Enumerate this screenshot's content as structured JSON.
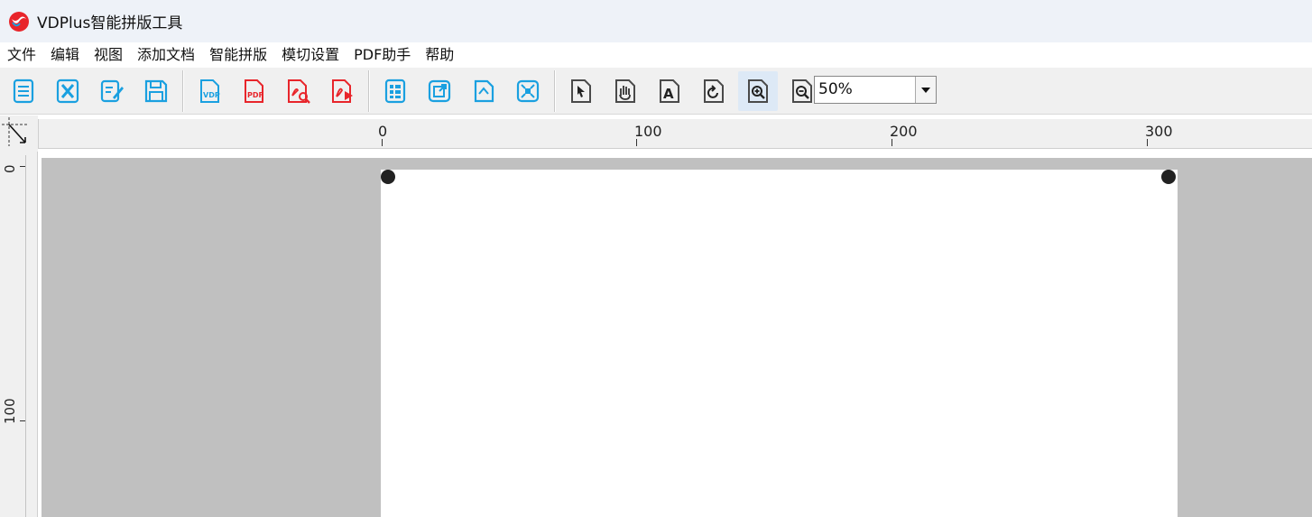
{
  "app": {
    "title": "VDPlus智能拼版工具",
    "logo_icon": "vdplus-logo-icon"
  },
  "menu": {
    "items": [
      "文件",
      "编辑",
      "视图",
      "添加文档",
      "智能拼版",
      "模切设置",
      "PDF助手",
      "帮助"
    ]
  },
  "toolbar": {
    "groups": [
      [
        "new-document-icon",
        "close-document-icon",
        "edit-document-icon",
        "save-icon"
      ],
      [
        "vdp-export-icon",
        "pdf-export-icon",
        "pdf-preview-icon",
        "acrobat-icon"
      ],
      [
        "layout-grid-icon",
        "export-page-icon",
        "crop-page-icon",
        "fit-page-icon"
      ],
      [
        "select-arrow-icon",
        "hand-pan-icon",
        "text-tool-icon",
        "rotate-icon",
        "zoom-in-icon",
        "zoom-out-icon"
      ]
    ],
    "icon_labels": {
      "vdp": "VDP",
      "pdf": "PDF",
      "text": "A"
    },
    "zoom": {
      "value": "50%"
    }
  },
  "rulers": {
    "horizontal": [
      "0",
      "100",
      "200",
      "300"
    ],
    "vertical": [
      "0",
      "100"
    ]
  },
  "colors": {
    "blue_icon": "#1aa0e0",
    "red_icon": "#e8252b",
    "gray_icon": "#4a4a4a",
    "canvas_bg": "#c0c0c0",
    "page_bg": "#ffffff"
  }
}
